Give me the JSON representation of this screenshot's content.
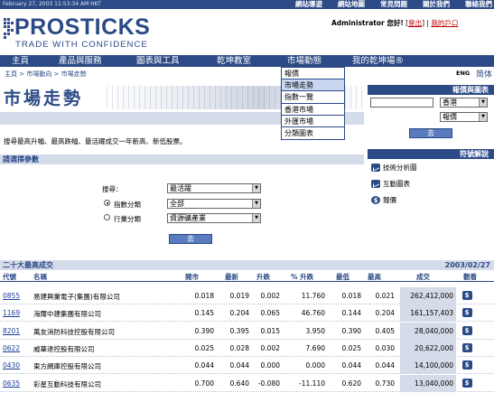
{
  "topbar": {
    "timestamp": "February 27, 2003 11:53:34 AM HKT",
    "links": [
      "網站導遊",
      "網站地圖",
      "常見問題",
      "關於我們",
      "聯絡我們"
    ]
  },
  "logo": {
    "brand": "PROSTICKS",
    "tagline": "TRADE WITH CONFIDENCE"
  },
  "admin": {
    "greeting": "Administrator 您好!",
    "logout": "登出",
    "account": "我的戶口",
    "separator": "|",
    "open_bracket": "[",
    "close_bracket": "]"
  },
  "nav": {
    "items": [
      "主頁",
      "產品與服務",
      "圖表與工具",
      "乾坤教室",
      "市場動態",
      "我的乾坤場®"
    ]
  },
  "breadcrumb": "主頁 > 市場動向 > 市場走勢",
  "lang": {
    "eng": "ENG",
    "simplified": "简体"
  },
  "dropdown": {
    "items": [
      "報價",
      "市場走勢",
      "指數一覽",
      "香港市場",
      "外匯市場",
      "分類圖表"
    ],
    "selected": 1
  },
  "page_title": "市場走勢",
  "description": "搜尋最高升幅、最高跌幅、最活躍成交一年新高、新低股票。",
  "params": {
    "heading": "請選擇參數",
    "search_label": "搜尋：",
    "search_value": "最活躍",
    "radio1_label": "指數分類",
    "radio1_value": "全部",
    "radio2_label": "行業分類",
    "radio2_value": "資源礦產業",
    "go": "去"
  },
  "side": {
    "quote_heading": "報價與圖表",
    "market_value": "香港",
    "type_value": "報價",
    "go": "去",
    "tools_heading": "符號解說",
    "tools": [
      {
        "icon": "chart-tool-icon",
        "label": "技術分析圖"
      },
      {
        "icon": "interactive-chart-icon",
        "label": "互動圖表"
      },
      {
        "icon": "dollar-coin-icon",
        "label": "報價"
      }
    ]
  },
  "table": {
    "title": "二十大最高成交",
    "date": "2003/02/27",
    "columns": [
      "代號",
      "名稱",
      "開市",
      "最新",
      "升跌",
      "% 升跌",
      "最低",
      "最高",
      "成交",
      "觀看"
    ],
    "rows": [
      [
        "0855",
        "易建興業電子(集團)有限公司",
        "0.018",
        "0.019",
        "0.002",
        "11.760",
        "0.018",
        "0.021",
        "262,412,000"
      ],
      [
        "1169",
        "海爾中建集團有限公司",
        "0.145",
        "0.204",
        "0.065",
        "46.760",
        "0.144",
        "0.204",
        "161,157,403"
      ],
      [
        "8201",
        "萬友消防科技控股有限公司",
        "0.390",
        "0.395",
        "0.015",
        "3.950",
        "0.390",
        "0.405",
        "28,040,000"
      ],
      [
        "0622",
        "威華達控股有限公司",
        "0.025",
        "0.028",
        "0.002",
        "7.690",
        "0.025",
        "0.030",
        "20,622,000"
      ],
      [
        "0430",
        "東方網庫控股有限公司",
        "0.044",
        "0.044",
        "0.000",
        "0.000",
        "0.044",
        "0.044",
        "14,100,000"
      ],
      [
        "0635",
        "彩星互動科技有限公司",
        "0.700",
        "0.640",
        "-0.080",
        "-11.110",
        "0.620",
        "0.730",
        "13,040,000"
      ]
    ]
  },
  "colors": {
    "brand": "#2b4a86",
    "band": "#d4dbe9",
    "highlight": "#c9d8f0",
    "logout": "#c00000"
  }
}
